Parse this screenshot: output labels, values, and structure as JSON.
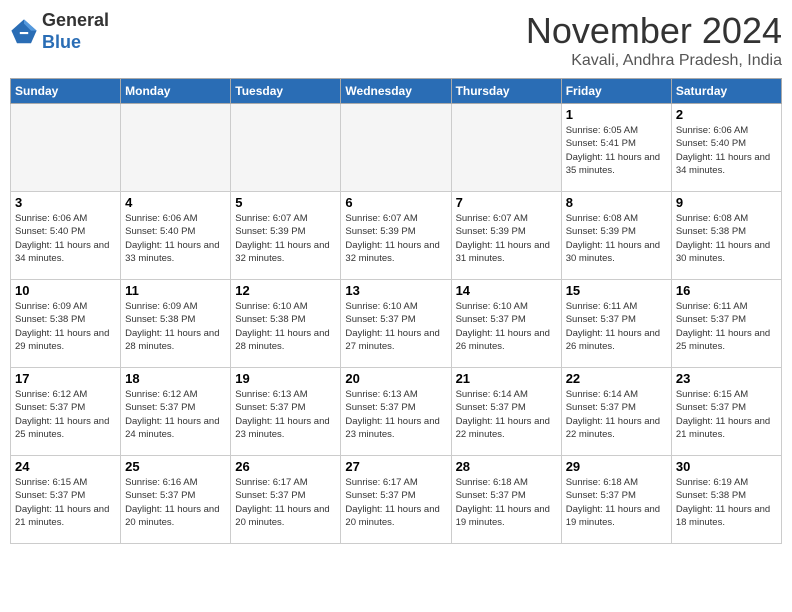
{
  "logo": {
    "general": "General",
    "blue": "Blue"
  },
  "header": {
    "month": "November 2024",
    "location": "Kavali, Andhra Pradesh, India"
  },
  "weekdays": [
    "Sunday",
    "Monday",
    "Tuesday",
    "Wednesday",
    "Thursday",
    "Friday",
    "Saturday"
  ],
  "weeks": [
    [
      {
        "day": "",
        "info": ""
      },
      {
        "day": "",
        "info": ""
      },
      {
        "day": "",
        "info": ""
      },
      {
        "day": "",
        "info": ""
      },
      {
        "day": "",
        "info": ""
      },
      {
        "day": "1",
        "info": "Sunrise: 6:05 AM\nSunset: 5:41 PM\nDaylight: 11 hours and 35 minutes."
      },
      {
        "day": "2",
        "info": "Sunrise: 6:06 AM\nSunset: 5:40 PM\nDaylight: 11 hours and 34 minutes."
      }
    ],
    [
      {
        "day": "3",
        "info": "Sunrise: 6:06 AM\nSunset: 5:40 PM\nDaylight: 11 hours and 34 minutes."
      },
      {
        "day": "4",
        "info": "Sunrise: 6:06 AM\nSunset: 5:40 PM\nDaylight: 11 hours and 33 minutes."
      },
      {
        "day": "5",
        "info": "Sunrise: 6:07 AM\nSunset: 5:39 PM\nDaylight: 11 hours and 32 minutes."
      },
      {
        "day": "6",
        "info": "Sunrise: 6:07 AM\nSunset: 5:39 PM\nDaylight: 11 hours and 32 minutes."
      },
      {
        "day": "7",
        "info": "Sunrise: 6:07 AM\nSunset: 5:39 PM\nDaylight: 11 hours and 31 minutes."
      },
      {
        "day": "8",
        "info": "Sunrise: 6:08 AM\nSunset: 5:39 PM\nDaylight: 11 hours and 30 minutes."
      },
      {
        "day": "9",
        "info": "Sunrise: 6:08 AM\nSunset: 5:38 PM\nDaylight: 11 hours and 30 minutes."
      }
    ],
    [
      {
        "day": "10",
        "info": "Sunrise: 6:09 AM\nSunset: 5:38 PM\nDaylight: 11 hours and 29 minutes."
      },
      {
        "day": "11",
        "info": "Sunrise: 6:09 AM\nSunset: 5:38 PM\nDaylight: 11 hours and 28 minutes."
      },
      {
        "day": "12",
        "info": "Sunrise: 6:10 AM\nSunset: 5:38 PM\nDaylight: 11 hours and 28 minutes."
      },
      {
        "day": "13",
        "info": "Sunrise: 6:10 AM\nSunset: 5:37 PM\nDaylight: 11 hours and 27 minutes."
      },
      {
        "day": "14",
        "info": "Sunrise: 6:10 AM\nSunset: 5:37 PM\nDaylight: 11 hours and 26 minutes."
      },
      {
        "day": "15",
        "info": "Sunrise: 6:11 AM\nSunset: 5:37 PM\nDaylight: 11 hours and 26 minutes."
      },
      {
        "day": "16",
        "info": "Sunrise: 6:11 AM\nSunset: 5:37 PM\nDaylight: 11 hours and 25 minutes."
      }
    ],
    [
      {
        "day": "17",
        "info": "Sunrise: 6:12 AM\nSunset: 5:37 PM\nDaylight: 11 hours and 25 minutes."
      },
      {
        "day": "18",
        "info": "Sunrise: 6:12 AM\nSunset: 5:37 PM\nDaylight: 11 hours and 24 minutes."
      },
      {
        "day": "19",
        "info": "Sunrise: 6:13 AM\nSunset: 5:37 PM\nDaylight: 11 hours and 23 minutes."
      },
      {
        "day": "20",
        "info": "Sunrise: 6:13 AM\nSunset: 5:37 PM\nDaylight: 11 hours and 23 minutes."
      },
      {
        "day": "21",
        "info": "Sunrise: 6:14 AM\nSunset: 5:37 PM\nDaylight: 11 hours and 22 minutes."
      },
      {
        "day": "22",
        "info": "Sunrise: 6:14 AM\nSunset: 5:37 PM\nDaylight: 11 hours and 22 minutes."
      },
      {
        "day": "23",
        "info": "Sunrise: 6:15 AM\nSunset: 5:37 PM\nDaylight: 11 hours and 21 minutes."
      }
    ],
    [
      {
        "day": "24",
        "info": "Sunrise: 6:15 AM\nSunset: 5:37 PM\nDaylight: 11 hours and 21 minutes."
      },
      {
        "day": "25",
        "info": "Sunrise: 6:16 AM\nSunset: 5:37 PM\nDaylight: 11 hours and 20 minutes."
      },
      {
        "day": "26",
        "info": "Sunrise: 6:17 AM\nSunset: 5:37 PM\nDaylight: 11 hours and 20 minutes."
      },
      {
        "day": "27",
        "info": "Sunrise: 6:17 AM\nSunset: 5:37 PM\nDaylight: 11 hours and 20 minutes."
      },
      {
        "day": "28",
        "info": "Sunrise: 6:18 AM\nSunset: 5:37 PM\nDaylight: 11 hours and 19 minutes."
      },
      {
        "day": "29",
        "info": "Sunrise: 6:18 AM\nSunset: 5:37 PM\nDaylight: 11 hours and 19 minutes."
      },
      {
        "day": "30",
        "info": "Sunrise: 6:19 AM\nSunset: 5:38 PM\nDaylight: 11 hours and 18 minutes."
      }
    ]
  ]
}
